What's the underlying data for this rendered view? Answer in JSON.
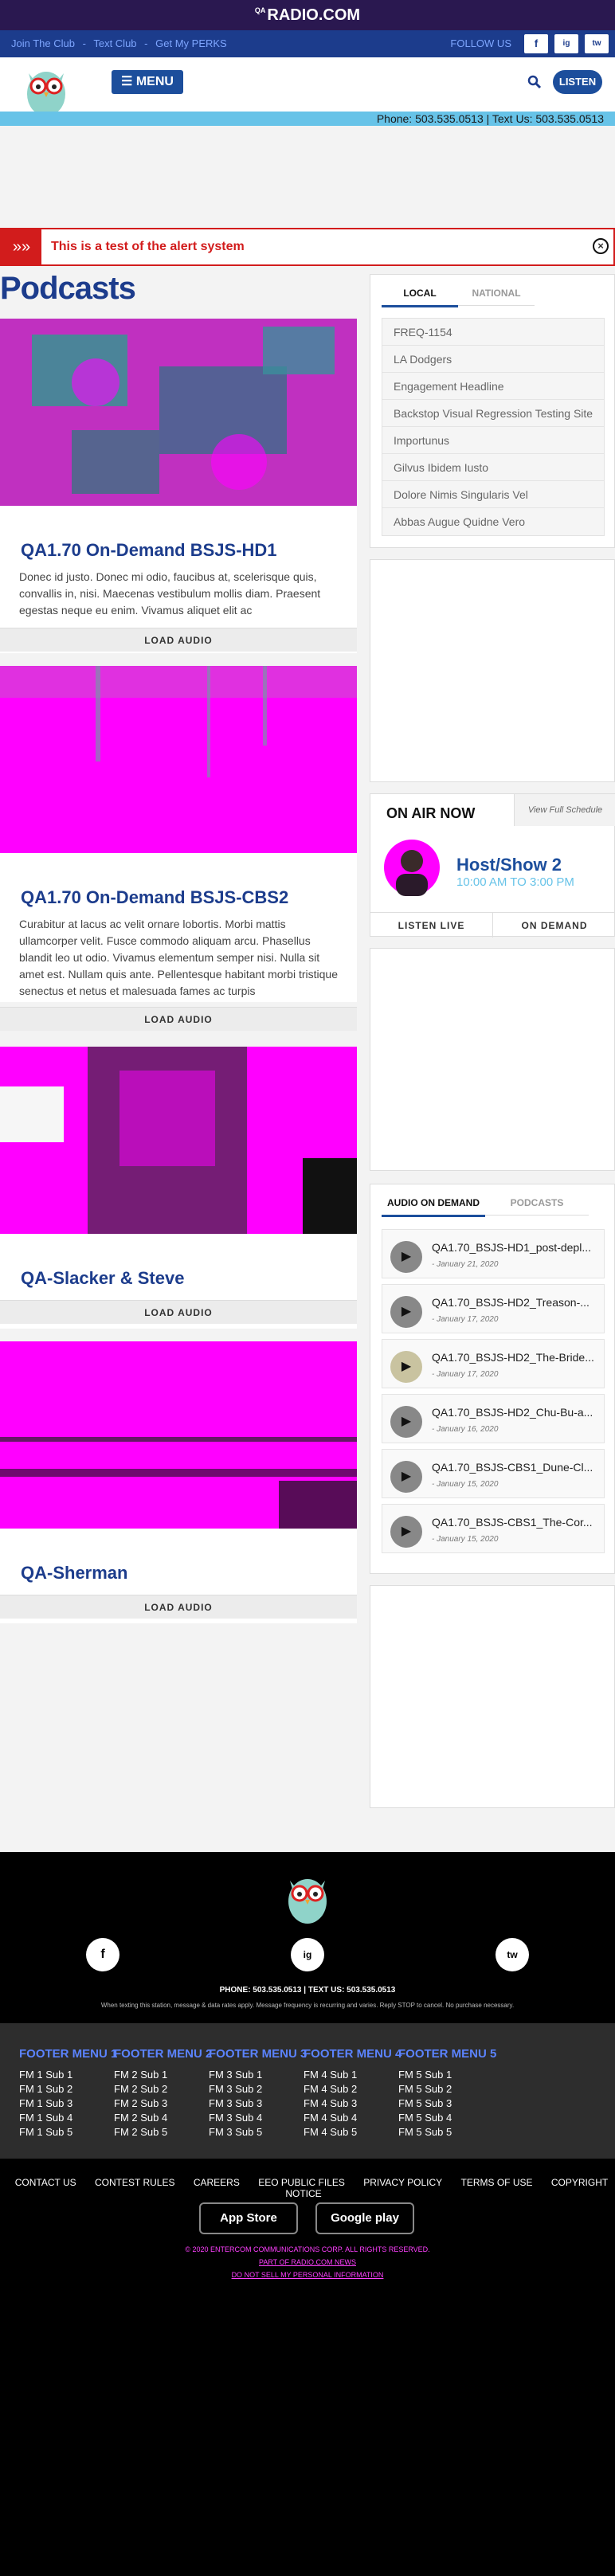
{
  "header": {
    "logo": "RADIO.COM",
    "logo_prefix": "QA",
    "links": [
      "Join The Club",
      "Text Club",
      "Get My PERKS"
    ],
    "separator": "-",
    "follow": "FOLLOW US",
    "social": [
      "f",
      "ig",
      "tw"
    ],
    "menu": "☰ MENU",
    "listen": "LISTEN",
    "phone_line": "Phone: 503.535.0513 | Text Us: 503.535.0513"
  },
  "alert": {
    "chevron": "»»",
    "text": "This is a test of the alert system",
    "close": "×"
  },
  "page_title": "Podcasts",
  "cards": [
    {
      "title": "QA1.70 On-Demand BSJS-HD1",
      "desc": "Donec id justo. Donec mi odio, faucibus at, scelerisque quis, convallis in, nisi. Maecenas vestibulum mollis diam. Praesent egestas neque eu enim. Vivamus aliquet elit ac",
      "action": "LOAD AUDIO"
    },
    {
      "title": "QA1.70 On-Demand BSJS-CBS2",
      "desc": "Curabitur at lacus ac velit ornare lobortis. Morbi mattis ullamcorper velit. Fusce commodo aliquam arcu. Phasellus blandit leo ut odio. Vivamus elementum semper nisi. Nulla sit amet est. Nullam quis ante. Pellentesque habitant morbi tristique senectus et netus et malesuada fames ac turpis",
      "action": "LOAD AUDIO"
    },
    {
      "title": "QA-Slacker & Steve",
      "desc": "",
      "action": "LOAD AUDIO"
    },
    {
      "title": "QA-Sherman",
      "desc": "",
      "action": "LOAD AUDIO"
    }
  ],
  "local_widget": {
    "tabs": [
      "LOCAL",
      "NATIONAL"
    ],
    "items": [
      "FREQ-1154",
      "LA Dodgers",
      "Engagement Headline",
      "Backstop Visual Regression Testing Site",
      "Importunus",
      "Gilvus Ibidem Iusto",
      "Dolore Nimis Singularis Vel",
      "Abbas Augue Quidne Vero"
    ]
  },
  "on_air": {
    "title": "ON AIR NOW",
    "schedule": "View Full Schedule",
    "show": "Host/Show 2",
    "time": "10:00 AM TO 3:00 PM",
    "listen_live": "LISTEN LIVE",
    "on_demand": "ON DEMAND"
  },
  "audio_widget": {
    "tabs": [
      "AUDIO ON DEMAND",
      "PODCASTS"
    ],
    "episodes": [
      {
        "title": "QA1.70_BSJS-HD1_post-depl...",
        "date": "- January 21, 2020"
      },
      {
        "title": "QA1.70_BSJS-HD2_Treason-...",
        "date": "- January 17, 2020"
      },
      {
        "title": "QA1.70_BSJS-HD2_The-Bride...",
        "date": "- January 17, 2020"
      },
      {
        "title": "QA1.70_BSJS-HD2_Chu-Bu-a...",
        "date": "- January 16, 2020"
      },
      {
        "title": "QA1.70_BSJS-CBS1_Dune-Cl...",
        "date": "- January 15, 2020"
      },
      {
        "title": "QA1.70_BSJS-CBS1_The-Cor...",
        "date": "- January 15, 2020"
      }
    ],
    "play_icon": "▶"
  },
  "footer": {
    "social": [
      "f",
      "ig",
      "tw"
    ],
    "phone": "PHONE: 503.535.0513 | TEXT US: 503.535.0513",
    "disclaimer": "When texting this station, message & data rates apply. Message frequency is recurring and varies. Reply STOP to cancel. No purchase necessary.",
    "menus": [
      {
        "title": "FOOTER MENU 1",
        "items": [
          "FM 1 Sub 1",
          "FM 1 Sub 2",
          "FM 1 Sub 3",
          "FM 1 Sub 4",
          "FM 1 Sub 5"
        ]
      },
      {
        "title": "FOOTER MENU 2",
        "items": [
          "FM 2 Sub 1",
          "FM 2 Sub 2",
          "FM 2 Sub 3",
          "FM 2 Sub 4",
          "FM 2 Sub 5"
        ]
      },
      {
        "title": "FOOTER MENU 3",
        "items": [
          "FM 3 Sub 1",
          "FM 3 Sub 2",
          "FM 3 Sub 3",
          "FM 3 Sub 4",
          "FM 3 Sub 5"
        ]
      },
      {
        "title": "FOOTER MENU 4",
        "items": [
          "FM 4 Sub 1",
          "FM 4 Sub 2",
          "FM 4 Sub 3",
          "FM 4 Sub 4",
          "FM 4 Sub 5"
        ]
      },
      {
        "title": "FOOTER MENU 5",
        "items": [
          "FM 5 Sub 1",
          "FM 5 Sub 2",
          "FM 5 Sub 3",
          "FM 5 Sub 4",
          "FM 5 Sub 5"
        ]
      }
    ],
    "links": [
      "CONTACT US",
      "CONTEST RULES",
      "CAREERS",
      "EEO PUBLIC FILES",
      "PRIVACY POLICY",
      "TERMS OF USE",
      "COPYRIGHT NOTICE"
    ],
    "app_store": "App Store",
    "google_play": "Google play",
    "copyright": "© 2020 ENTERCOM COMMUNICATIONS CORP. ALL RIGHTS RESERVED.",
    "part_of": "PART OF RADIO.COM NEWS",
    "dns": "DO NOT SELL MY PERSONAL INFORMATION"
  },
  "colors": {
    "brand": "#1c3c8c",
    "alert": "#d21c1c",
    "accent": "#67c3e8",
    "image_fill": "#ff00ff"
  }
}
